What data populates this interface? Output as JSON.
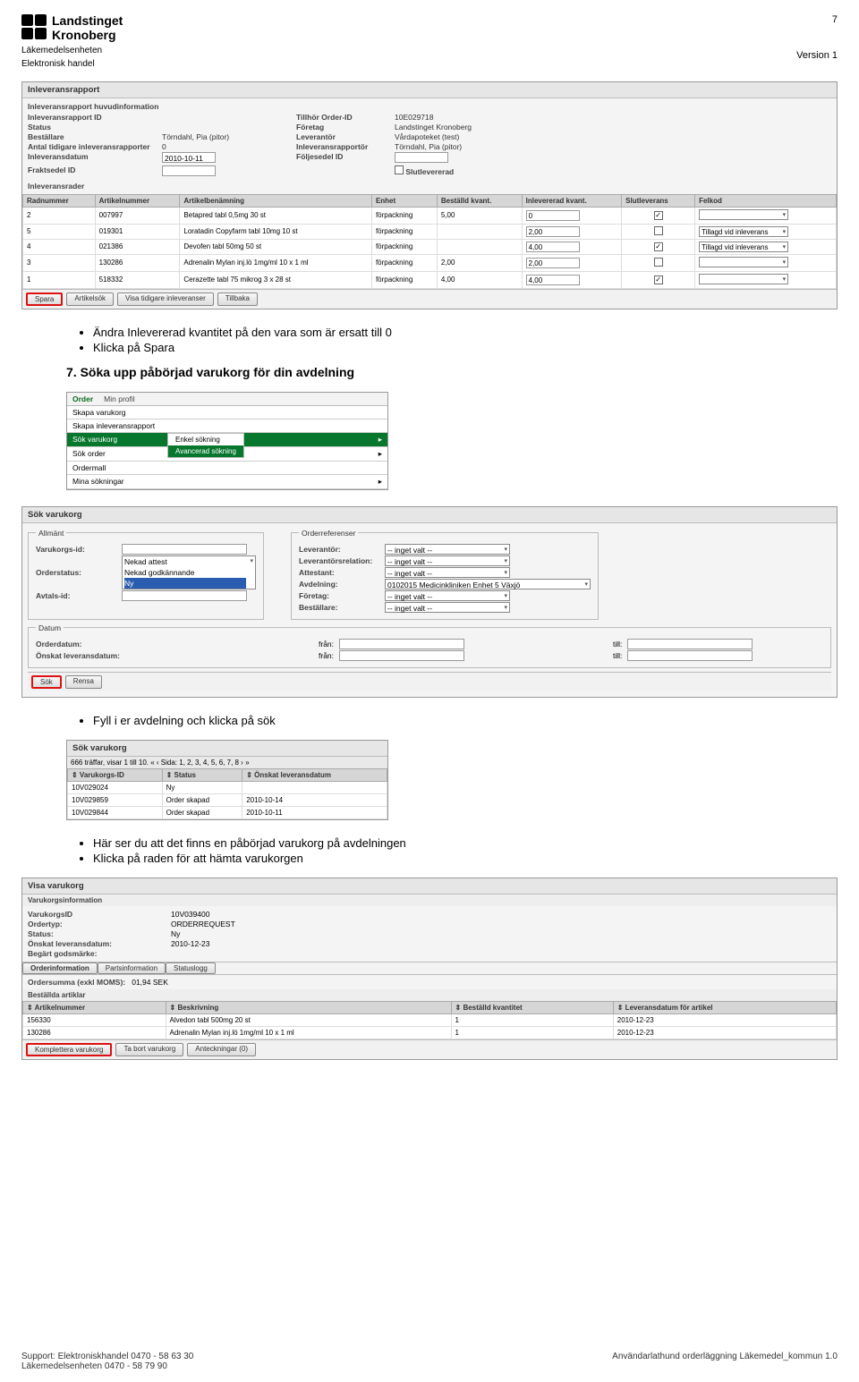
{
  "header": {
    "brand1": "Landstinget",
    "brand2": "Kronoberg",
    "unit1": "Läkemedelsenheten",
    "unit2": "Elektronisk handel",
    "page_number": "7",
    "version": "Version 1"
  },
  "shot1": {
    "title": "Inleveransrapport",
    "hdr_section": "Inleveransrapport huvudinformation",
    "labels": {
      "rapport_id": "Inleveransrapport ID",
      "order_id": "Tillhör Order-ID",
      "order_id_v": "10E029718",
      "status": "Status",
      "foretag": "Företag",
      "foretag_v": "Landstinget Kronoberg",
      "bestallare": "Beställare",
      "bestallare_v": "Törndahl, Pia (pitor)",
      "leverantor": "Leverantör",
      "leverantor_v": "Vårdapoteket (test)",
      "antal": "Antal tidigare inleveransrapporter",
      "antal_v": "0",
      "rapportor": "Inleveransrapportör",
      "rapportor_v": "Törndahl, Pia (pitor)",
      "datum": "Inleveransdatum",
      "datum_v": "2010-10-11",
      "foljesedel": "Följesedel ID",
      "fraktsedel": "Fraktsedel ID",
      "slutlev": "Slutlevererad",
      "rader": "Inleveransrader"
    },
    "cols": [
      "Radnummer",
      "Artikelnummer",
      "Artikelbenämning",
      "Enhet",
      "Beställd kvant.",
      "Inlevererad kvant.",
      "Slutleverans",
      "Felkod"
    ],
    "rows": [
      {
        "rn": "2",
        "art": "007997",
        "name": "Betapred tabl 0,5mg 30 st",
        "unit": "förpackning",
        "best": "5,00",
        "inlev": "0",
        "slut": true,
        "fel": ""
      },
      {
        "rn": "5",
        "art": "019301",
        "name": "Loratadin Copyfarm tabl 10mg 10 st",
        "unit": "förpackning",
        "best": "",
        "inlev": "2,00",
        "slut": false,
        "fel": "Tillagd vid inleverans"
      },
      {
        "rn": "4",
        "art": "021386",
        "name": "Devofen tabl 50mg 50 st",
        "unit": "förpackning",
        "best": "",
        "inlev": "4,00",
        "slut": true,
        "fel": "Tillagd vid inleverans"
      },
      {
        "rn": "3",
        "art": "130286",
        "name": "Adrenalin Mylan inj.lö 1mg/ml 10 x 1 ml",
        "unit": "förpackning",
        "best": "2,00",
        "inlev": "2,00",
        "slut": false,
        "fel": ""
      },
      {
        "rn": "1",
        "art": "518332",
        "name": "Cerazette tabl 75 mikrog 3 x 28 st",
        "unit": "förpackning",
        "best": "4,00",
        "inlev": "4,00",
        "slut": true,
        "fel": ""
      }
    ],
    "buttons": [
      "Spara",
      "Artikelsök",
      "Visa tidigare inleveranser",
      "Tillbaka"
    ]
  },
  "bullets1": {
    "b1": "Ändra Inlevererad kvantitet på den vara som är ersatt till 0",
    "b2": "Klicka på Spara"
  },
  "section7": "7. Söka upp påbörjad varukorg för din avdelning",
  "menu": {
    "tabs": [
      "Order",
      "Min profil"
    ],
    "items": [
      "Skapa varukorg",
      "Skapa inleveransrapport",
      "Sök varukorg",
      "Sök order",
      "Ordermall",
      "Mina sökningar"
    ],
    "fly": [
      "Enkel sökning",
      "Avancerad sökning"
    ]
  },
  "search": {
    "title": "Sök varukorg",
    "fs1": "Allmänt",
    "fs2": "Orderreferenser",
    "fs3": "Datum",
    "varukorgs_id": "Varukorgs-id:",
    "orderstatus": "Orderstatus:",
    "orderstatus_opts": [
      "Nekad attest",
      "Nekad godkännande",
      "Ny"
    ],
    "avtals_id": "Avtals-id:",
    "leverantor": "Leverantör:",
    "levrel": "Leverantörsrelation:",
    "attestant": "Attestant:",
    "avdelning": "Avdelning:",
    "avdelning_v": "0102015 Medicinkliniken Enhet 5 Växjö",
    "foretag": "Företag:",
    "bestallare": "Beställare:",
    "inget": "-- inget valt --",
    "orderdatum": "Orderdatum:",
    "onskat": "Önskat leveransdatum:",
    "fran": "från:",
    "till": "till:",
    "btn_sok": "Sök",
    "btn_rensa": "Rensa"
  },
  "bullets2": {
    "b1": "Fyll i er avdelning och klicka på sök"
  },
  "results": {
    "title": "Sök varukorg",
    "info": "666 träffar, visar 1 till 10. « ‹ Sida: 1, 2, 3, 4, 5, 6, 7, 8 › »",
    "cols": [
      "Varukorgs-ID",
      "Status",
      "Önskat leveransdatum"
    ],
    "rows": [
      {
        "id": "10V029024",
        "status": "Ny",
        "date": ""
      },
      {
        "id": "10V029859",
        "status": "Order skapad",
        "date": "2010-10-14"
      },
      {
        "id": "10V029844",
        "status": "Order skapad",
        "date": "2010-10-11"
      }
    ]
  },
  "bullets3": {
    "b1": "Här ser du att det finns en påbörjad varukorg på avdelningen",
    "b2": "Klicka på raden för att hämta varukorgen"
  },
  "view": {
    "title": "Visa varukorg",
    "sub": "Varukorgsinformation",
    "fields": {
      "VarukorgsID": "10V039400",
      "Ordertyp:": "ORDERREQUEST",
      "Status:": "Ny",
      "Önskat leveransdatum:": "2010-12-23",
      "Begärt godsmärke:": ""
    },
    "tabs": [
      "Orderinformation",
      "Partsinformation",
      "Statuslogg"
    ],
    "sum_lbl": "Ordersumma (exkl MOMS):",
    "sum_v": "01,94 SEK",
    "sect": "Beställda artiklar",
    "cols": [
      "Artikelnummer",
      "Beskrivning",
      "Beställd kvantitet",
      "Leveransdatum för artikel"
    ],
    "rows": [
      {
        "a": "156330",
        "b": "Alvedon tabl 500mg 20 st",
        "c": "1",
        "d": "2010-12-23"
      },
      {
        "a": "130286",
        "b": "Adrenalin Mylan inj.lö 1mg/ml 10 x 1 ml",
        "c": "1",
        "d": "2010-12-23"
      }
    ],
    "buttons": [
      "Komplettera varukorg",
      "Ta bort varukorg",
      "Anteckningar (0)"
    ]
  },
  "footer": {
    "l1": "Support: Elektroniskhandel  0470 - 58 63 30",
    "l2": "Läkemedelsenheten  0470 - 58 79 90",
    "r": "Användarlathund orderläggning Läkemedel_kommun 1.0"
  }
}
